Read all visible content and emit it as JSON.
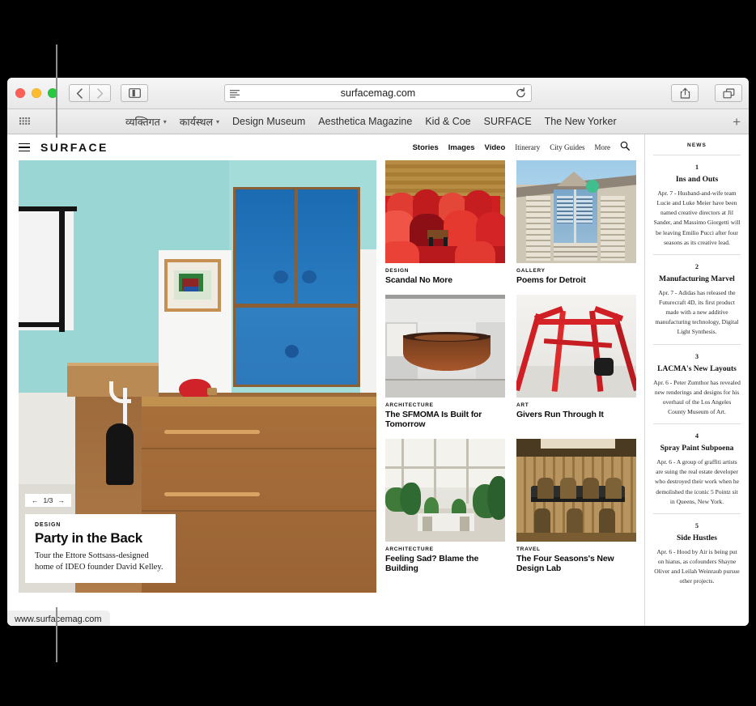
{
  "browser": {
    "url": "surfacemag.com",
    "status_url": "www.surfacemag.com",
    "buttons": {
      "back": "back-arrow",
      "forward": "forward-arrow",
      "sidebar": "sidebar-icon",
      "reader": "reader-icon",
      "reload": "reload-icon",
      "share": "share-icon",
      "tabs": "tab-overview-icon",
      "add_bookmark": "plus-icon"
    },
    "bookmarks": [
      {
        "label": "व्यक्तिगत",
        "has_caret": true
      },
      {
        "label": "कार्यस्थल",
        "has_caret": true
      },
      {
        "label": "Design Museum",
        "has_caret": false
      },
      {
        "label": "Aesthetica Magazine",
        "has_caret": false
      },
      {
        "label": "Kid & Coe",
        "has_caret": false
      },
      {
        "label": "SURFACE",
        "has_caret": false
      },
      {
        "label": "The New Yorker",
        "has_caret": false
      }
    ]
  },
  "site": {
    "brand": "SURFACE",
    "nav_main": [
      "Stories",
      "Images",
      "Video"
    ],
    "nav_sub": [
      "Itinerary",
      "City Guides",
      "More"
    ],
    "search": "search-icon"
  },
  "hero": {
    "slide_prev": "←",
    "slide_counter": "1/3",
    "slide_next": "→",
    "kicker": "DESIGN",
    "title": "Party in the Back",
    "subtitle": "Tour the Ettore Sottsass-designed home of IDEO founder David Kelley."
  },
  "cards": [
    {
      "kicker": "DESIGN",
      "title": "Scandal No More"
    },
    {
      "kicker": "GALLERY",
      "title": "Poems for Detroit"
    },
    {
      "kicker": "ARCHITECTURE",
      "title": "The SFMOMA Is Built for Tomorrow"
    },
    {
      "kicker": "ART",
      "title": "Givers Run Through It"
    },
    {
      "kicker": "ARCHITECTURE",
      "title": "Feeling Sad? Blame the Building"
    },
    {
      "kicker": "TRAVEL",
      "title": "The Four Seasons's New Design Lab"
    }
  ],
  "news": {
    "heading": "NEWS",
    "items": [
      {
        "number": "1",
        "title": "Ins and Outs",
        "body": "Apr. 7 - Husband-and-wife team Lucie and Luke Meier have been named creative directors at Jil Sander, and Massimo Giorgetti will be leaving Emilio Pucci after four seasons as its creative lead."
      },
      {
        "number": "2",
        "title": "Manufacturing Marvel",
        "body": "Apr. 7 - Adidas has released the Futurecraft 4D, its first product made with a new additive manufacturing technology, Digital Light Synthesis."
      },
      {
        "number": "3",
        "title": "LACMA's New Layouts",
        "body": "Apr. 6 - Peter Zumthor has revealed new renderings and designs for his overhaul of the Los Angeles County Museum of Art."
      },
      {
        "number": "4",
        "title": "Spray Paint Subpoena",
        "body": "Apr. 6 - A group of graffiti artists are suing the real estate developer who destroyed their work when he demolished the iconic 5 Pointz sit in Queens, New York."
      },
      {
        "number": "5",
        "title": "Side Hustles",
        "body": "Apr. 6 - Hood by Air is being put on hiatus, as cofounders Shayne Oliver and Leilah Weinraub pursue other projects."
      }
    ]
  },
  "colors": {
    "hero_wall": "#9ed9d7",
    "cabinet_blue": "#1f6fb5",
    "accent_red": "#d8232a"
  }
}
